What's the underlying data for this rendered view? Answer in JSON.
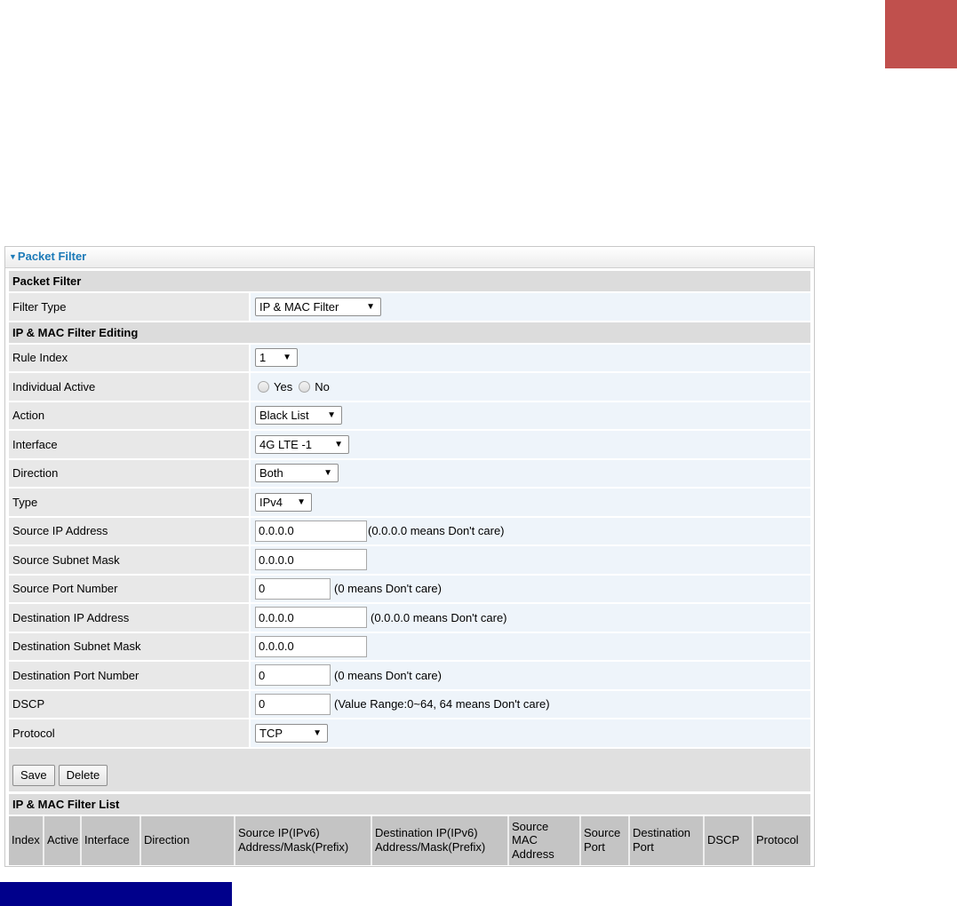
{
  "panel": {
    "title": "Packet Filter",
    "section_filter": "Packet Filter",
    "section_editing": "IP & MAC Filter Editing",
    "section_list": "IP & MAC Filter List"
  },
  "fields": {
    "filter_type": {
      "label": "Filter Type",
      "value": "IP & MAC Filter"
    },
    "rule_index": {
      "label": "Rule Index",
      "value": "1"
    },
    "individual_active": {
      "label": "Individual Active",
      "yes": "Yes",
      "no": "No"
    },
    "action": {
      "label": "Action",
      "value": "Black List"
    },
    "interface": {
      "label": "Interface",
      "value": "4G LTE -1"
    },
    "direction": {
      "label": "Direction",
      "value": "Both"
    },
    "type": {
      "label": "Type",
      "value": "IPv4"
    },
    "source_ip": {
      "label": "Source IP Address",
      "value": "0.0.0.0",
      "note": "(0.0.0.0 means Don't care)"
    },
    "source_mask": {
      "label": "Source Subnet Mask",
      "value": "0.0.0.0"
    },
    "source_port": {
      "label": "Source Port Number",
      "value": "0",
      "note": "(0 means Don't care)"
    },
    "dest_ip": {
      "label": "Destination IP Address",
      "value": "0.0.0.0",
      "note": "(0.0.0.0 means Don't care)"
    },
    "dest_mask": {
      "label": "Destination Subnet Mask",
      "value": "0.0.0.0"
    },
    "dest_port": {
      "label": "Destination Port Number",
      "value": "0",
      "note": "(0 means Don't care)"
    },
    "dscp": {
      "label": "DSCP",
      "value": "0",
      "note": "(Value Range:0~64, 64 means Don't care)"
    },
    "protocol": {
      "label": "Protocol",
      "value": "TCP"
    }
  },
  "buttons": {
    "save": "Save",
    "delete": "Delete"
  },
  "list_columns": [
    "Index",
    "Active",
    "Interface",
    "Direction",
    "Source IP(IPv6) Address/Mask(Prefix)",
    "Destination IP(IPv6) Address/Mask(Prefix)",
    "Source MAC Address",
    "Source Port",
    "Destination Port",
    "DSCP",
    "Protocol"
  ],
  "colors": {
    "accent_red": "#c0504d",
    "accent_navy": "#00008b",
    "title_blue": "#1c7ab8"
  }
}
